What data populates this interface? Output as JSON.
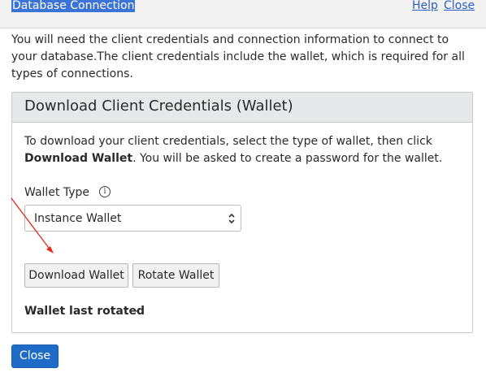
{
  "dialog": {
    "title": "Database Connection",
    "help_label": "Help",
    "close_link_label": "Close",
    "intro_text": "You will need the client credentials and connection information to connect to your database.The client credentials include the wallet, which is required for all types of connections."
  },
  "panel": {
    "title": "Download Client Credentials (Wallet)",
    "desc_part1": "To download your client credentials, select the type of wallet, then click ",
    "desc_bold": "Download Wallet",
    "desc_part2": ". You will be asked to create a password for the wallet.",
    "wallet_type_label": "Wallet Type",
    "info_icon": "info-icon",
    "wallet_type_value": "Instance Wallet",
    "download_button": "Download Wallet",
    "rotate_button": "Rotate Wallet",
    "last_rotated_label": "Wallet last rotated",
    "last_rotated_colon": ":",
    "last_rotated_value": "-"
  },
  "footer": {
    "close_button": "Close"
  },
  "colors": {
    "title_highlight": "#3b73d6",
    "link": "#2c5fc5",
    "primary_button": "#1f6bc8",
    "annotation_arrow": "#e0281e"
  }
}
